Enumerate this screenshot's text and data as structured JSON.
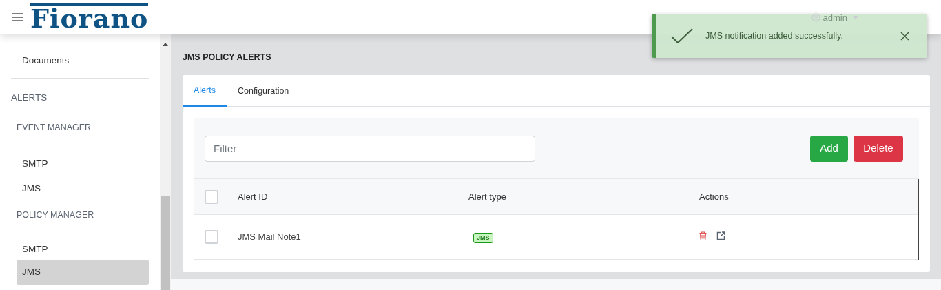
{
  "header": {
    "logo": "Fiorano",
    "user": "admin"
  },
  "toast": {
    "message": "JMS notification added successfully."
  },
  "sidebar": {
    "items": [
      {
        "kind": "link",
        "label": "Documents",
        "selected": false
      },
      {
        "kind": "section",
        "label": "ALERTS"
      },
      {
        "kind": "group",
        "label": "EVENT MANAGER"
      },
      {
        "kind": "link",
        "label": "SMTP",
        "selected": false
      },
      {
        "kind": "link",
        "label": "JMS",
        "selected": false
      },
      {
        "kind": "group",
        "label": "POLICY MANAGER"
      },
      {
        "kind": "link",
        "label": "SMTP",
        "selected": false
      },
      {
        "kind": "link",
        "label": "JMS",
        "selected": true
      }
    ]
  },
  "page_title": "JMS POLICY ALERTS",
  "tabs": [
    {
      "label": "Alerts",
      "selected": true
    },
    {
      "label": "Configuration",
      "selected": false
    }
  ],
  "filter": {
    "placeholder": "Filter"
  },
  "buttons": [
    {
      "kind": "add",
      "label": "Add"
    },
    {
      "kind": "delete",
      "label": "Delete"
    }
  ],
  "table": {
    "columns": [
      "Alert ID",
      "Alert type",
      "Actions"
    ],
    "header_checked": false,
    "rows": [
      {
        "checked": false,
        "alert_id": "JMS Mail Note1",
        "alert_type": "JMS"
      }
    ]
  }
}
